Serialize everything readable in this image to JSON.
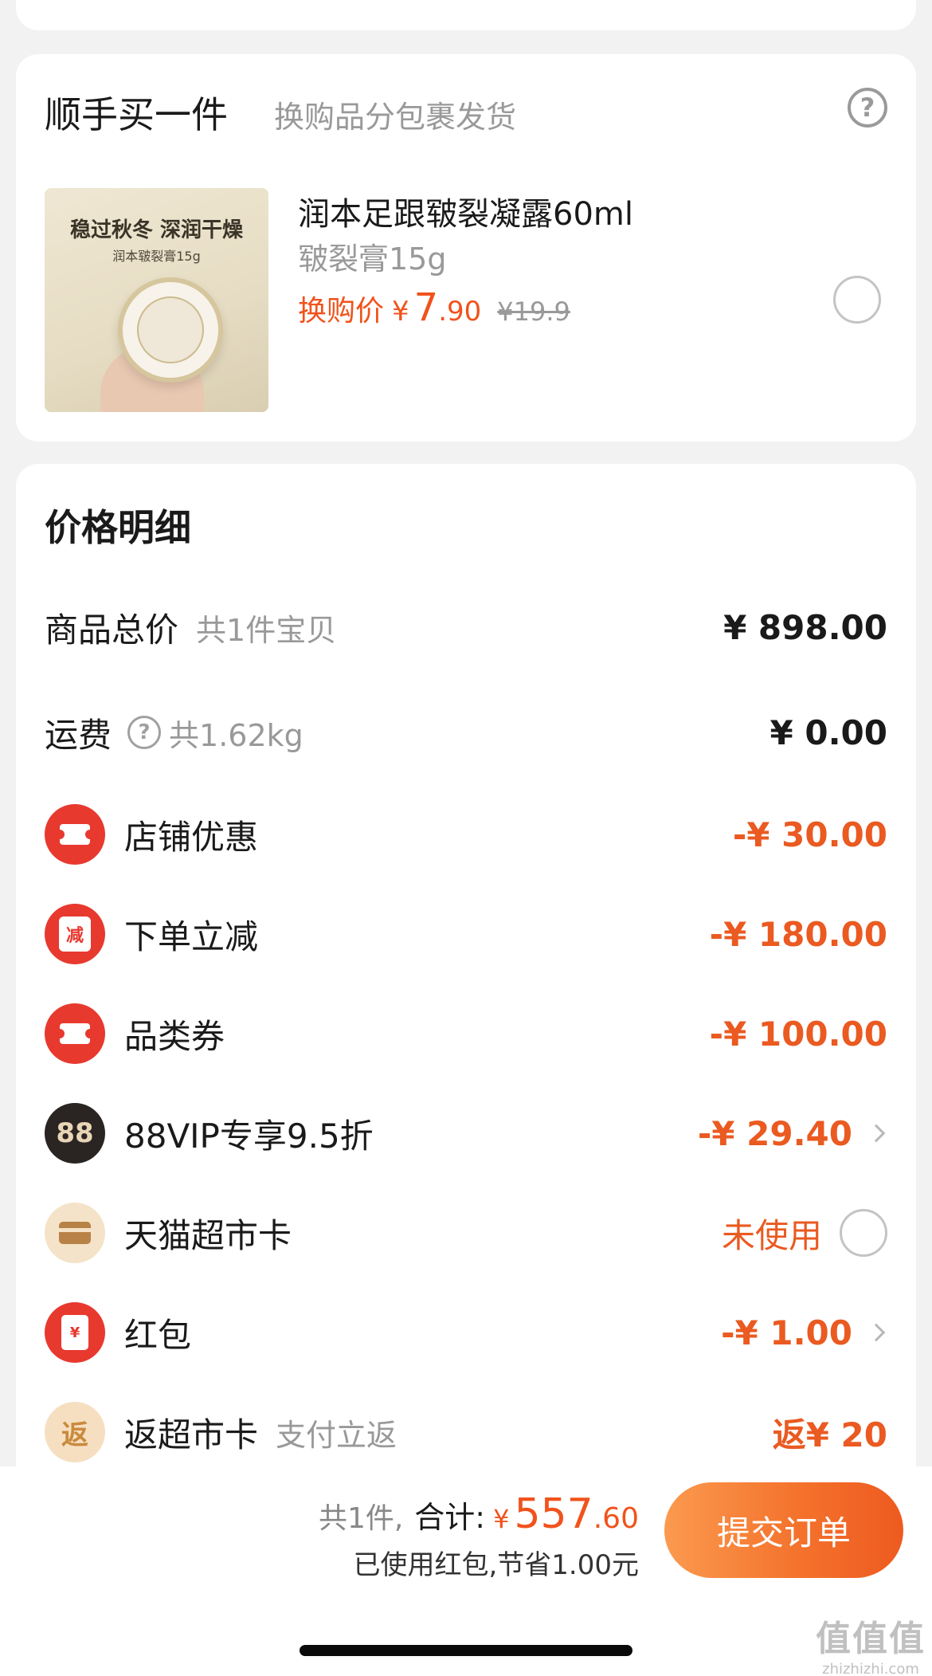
{
  "addon": {
    "title": "顺手买一件",
    "subtitle": "换购品分包裹发货",
    "product": {
      "image_line1": "稳过秋冬 深润干燥",
      "image_line2": "润本皲裂膏15g",
      "name": "润本足跟皲裂凝露60ml",
      "spec": "皲裂膏15g",
      "price_label": "换购价",
      "currency": "¥",
      "price_int": "7",
      "price_dec": ".90",
      "original_price": "¥19.9"
    }
  },
  "details": {
    "title": "价格明细",
    "goods_total": {
      "label": "商品总价",
      "note": "共1件宝贝",
      "value": "¥ 898.00"
    },
    "shipping": {
      "label": "运费",
      "note": "共1.62kg",
      "value": "¥ 0.00"
    },
    "shop_discount": {
      "label": "店铺优惠",
      "value": "-¥ 30.00",
      "icon": "ticket-icon"
    },
    "order_discount": {
      "label": "下单立减",
      "value": "-¥ 180.00",
      "icon_text": "减"
    },
    "category_coupon": {
      "label": "品类券",
      "value": "-¥ 100.00",
      "icon": "ticket-icon"
    },
    "vip": {
      "label": "88VIP专享9.5折",
      "value": "-¥ 29.40",
      "icon_text": "88"
    },
    "supermarket_card": {
      "label": "天猫超市卡",
      "value": "未使用",
      "icon": "card-icon"
    },
    "red_packet": {
      "label": "红包",
      "value": "-¥ 1.00",
      "icon_text": "¥"
    },
    "cashback": {
      "label": "返超市卡",
      "note": "支付立返",
      "value": "返¥ 20",
      "icon_text": "返"
    }
  },
  "footer": {
    "count": "共1件,",
    "total_label": "合计:",
    "currency": "¥",
    "total_int": "557",
    "total_dec": ".60",
    "savings": "已使用红包,节省1.00元",
    "submit": "提交订单"
  },
  "watermark": {
    "logo": "值值值",
    "url": "zhizhizhi.com"
  },
  "colors": {
    "accent": "#ea5a21",
    "price": "#f0531c",
    "icon_red": "#e8392f",
    "background": "#f2f2f2"
  }
}
